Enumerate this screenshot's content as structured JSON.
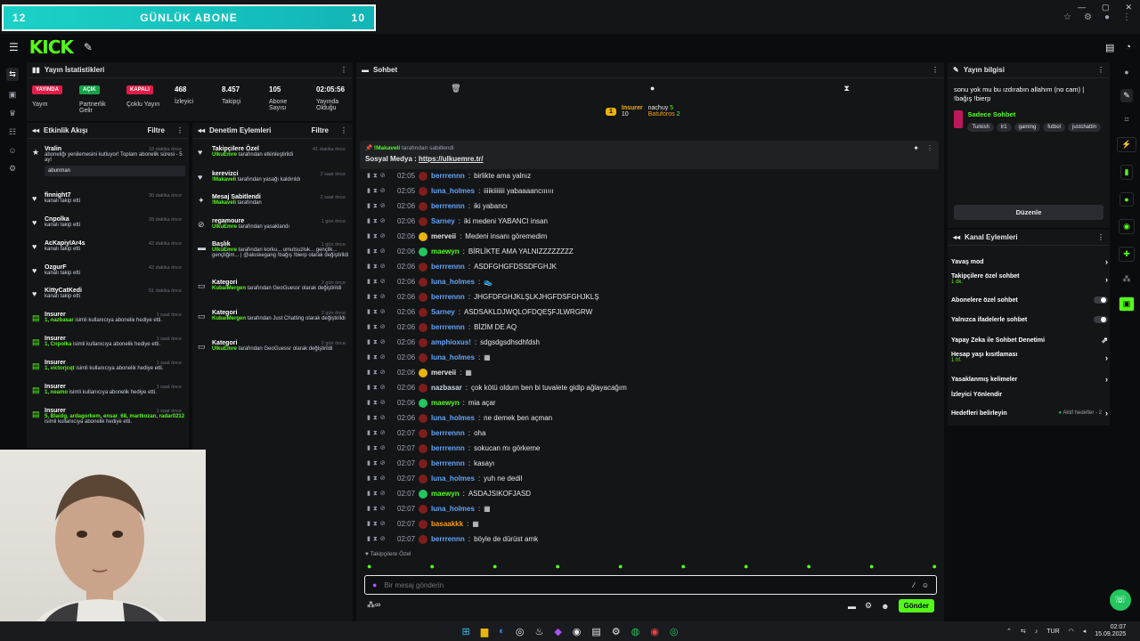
{
  "overlay": {
    "left": "12",
    "title": "GÜNLÜK ABONE",
    "right": "10"
  },
  "stats": {
    "title": "Yayın İstatistikleri",
    "badges": [
      {
        "text": "YAYINDA",
        "color": "#e11d48"
      },
      {
        "text": "AÇIK",
        "color": "#16a34a"
      },
      {
        "text": "KAPALI",
        "color": "#e11d48"
      }
    ],
    "labels": [
      "Yayın",
      "Partnerlik Gelir",
      "Çoklu Yayın"
    ],
    "values": [
      {
        "v": "468",
        "l": "İzleyici"
      },
      {
        "v": "8.457",
        "l": "Takipçi"
      },
      {
        "v": "105",
        "l": "Abone Sayısı"
      },
      {
        "v": "02:05:56",
        "l": "Yayında Olduğu"
      }
    ]
  },
  "feed": {
    "title": "Etkinlik Akışı",
    "filter": "Filtre",
    "items": [
      {
        "name": "Vralin",
        "time": "18 dakika önce",
        "text": "aboneliğı yenilemesini kutluyor! Toplam abonelik süresi - 5 ay!",
        "extra": "abunman"
      },
      {
        "name": "finnight7",
        "time": "30 dakika önce",
        "text": "kanalı takip etti"
      },
      {
        "name": "Cnpolka",
        "time": "39 dakika önce",
        "text": "kanalı takip etti"
      },
      {
        "name": "AcKapiyIAr4s",
        "time": "42 dakika önce",
        "text": "kanalı takip etti"
      },
      {
        "name": "OzgurF",
        "time": "42 dakika önce",
        "text": "kanalı takip etti"
      },
      {
        "name": "KittyCatKedi",
        "time": "51 dakika önce",
        "text": "kanalı takip etti"
      },
      {
        "name": "Insurer",
        "time": "1 saat önce",
        "hl": "1, nazbasar",
        "text": "isimli kullanıcıya aboneliк hediye etti."
      },
      {
        "name": "Insurer",
        "time": "1 saat önce",
        "hl": "1, Cnpolka",
        "text": "isimli kullanıcıya abonelik hediye etti."
      },
      {
        "name": "Insurer",
        "time": "1 saat önce",
        "hl": "1, victorjcqt",
        "text": "isimli kullanıcıya abonelik hediye etti."
      },
      {
        "name": "Insurer",
        "time": "1 saat önce",
        "hl": "1, neamo",
        "text": "isimli kullanıcıya abonelik hediye etti."
      },
      {
        "name": "Insurer",
        "time": "1 saat önce",
        "hl": "5, Blaidg, ardagorkem, ensar_68, martkozan, radar0212",
        "text": "isimli kullanıcıya abonelik hediye etti."
      }
    ]
  },
  "mod": {
    "title": "Denetim Eylemleri",
    "filter": "Filtre",
    "items": [
      {
        "title": "Takipçilere Özel",
        "time": "41 dakika önce",
        "who": "UlkuEmre",
        "text": "tarafından etkinleştirildi"
      },
      {
        "title": "kerevizci",
        "time": "2 saat önce",
        "who": "!Makaveli",
        "text": "tarafından yasağı kaldırıldı"
      },
      {
        "title": "Mesaj Sabitlendi",
        "time": "2 saat önce",
        "who": "!Makaveli",
        "text": "tarafından"
      },
      {
        "title": "regamoure",
        "time": "1 gün önce",
        "who": "UlkuEmre",
        "text": "tarafından yasaklandı"
      },
      {
        "title": "Başlık",
        "time": "1 gün önce",
        "who": "UlkuEmre",
        "text": "tarafından korku... umutsuzluk... gençlik... gençliğim... | @aloskegang !bağış !bierp olarak değiştirildi"
      },
      {
        "title": "Kategori",
        "time": "2 gün önce",
        "who": "KubaiMergen",
        "text": "tarafından GeoGuessr olarak değiştirildi"
      },
      {
        "title": "Kategori",
        "time": "2 gün önce",
        "who": "KubaiMergen",
        "text": "tarafından Just Chatting olarak değiştirildi"
      },
      {
        "title": "Kategori",
        "time": "2 gün önce",
        "who": "UlkuEmre",
        "text": "tarafından GeoGuessr olarak değiştirildi"
      }
    ]
  },
  "chat": {
    "title": "Sohbet",
    "top": {
      "insurer": "Insurer",
      "insurer_n": "10",
      "nachuy": "nachuy",
      "nachuy_n": "5",
      "batuforos": "Batuforos",
      "batuforos_n": "2"
    },
    "pinned": {
      "by": "!Makaveli",
      "by_text": "tarafından sabitlendi",
      "label": "Sosyal Medya :",
      "link": "https://ulkuemre.tr/"
    },
    "lines": [
      {
        "t": "02:05",
        "u": "berrrennn",
        "c": "#60a5fa",
        "m": "birlikte ama yalnız"
      },
      {
        "t": "02:05",
        "u": "luna_holmes",
        "c": "#60a5fa",
        "m": "iiiikiiiiiii yabaaaancıııııı"
      },
      {
        "t": "02:06",
        "u": "berrrennn",
        "c": "#60a5fa",
        "m": "iki yabancı"
      },
      {
        "t": "02:06",
        "u": "Sarney",
        "c": "#60a5fa",
        "m": "iki medeni YABANCI insan"
      },
      {
        "t": "02:06",
        "u": "merveii",
        "c": "#e5e7eb",
        "m": "Medeni insanı göremedim"
      },
      {
        "t": "02:06",
        "u": "maewyn",
        "c": "#53fc18",
        "m": "BİRLİKTE AMA YALNIZZZZZZZZ"
      },
      {
        "t": "02:06",
        "u": "berrrennn",
        "c": "#60a5fa",
        "m": "ASDFGHGFDSSDFGHJK"
      },
      {
        "t": "02:06",
        "u": "luna_holmes",
        "c": "#60a5fa",
        "m": "👟"
      },
      {
        "t": "02:06",
        "u": "berrrennn",
        "c": "#60a5fa",
        "m": "JHGFDFGHJKLŞLKJHGFDSFGHJKLŞ"
      },
      {
        "t": "02:06",
        "u": "Sarney",
        "c": "#60a5fa",
        "m": "ASDSAKLDJWQLOFDQEŞFJLWRGRW"
      },
      {
        "t": "02:06",
        "u": "berrrennn",
        "c": "#60a5fa",
        "m": "BİZİM DE AQ"
      },
      {
        "t": "02:06",
        "u": "amphioxus!",
        "c": "#60a5fa",
        "m": "sdgsdgsdhsdhfdsh"
      },
      {
        "t": "02:06",
        "u": "luna_holmes",
        "c": "#60a5fa",
        "m": "▦"
      },
      {
        "t": "02:06",
        "u": "merveii",
        "c": "#e5e7eb",
        "m": "▦"
      },
      {
        "t": "02:06",
        "u": "nazbasar",
        "c": "#cbd5e1",
        "m": "çok kötü oldum ben bi tuvalete gidip ağlayacağım"
      },
      {
        "t": "02:06",
        "u": "maewyn",
        "c": "#53fc18",
        "m": "mia açar"
      },
      {
        "t": "02:06",
        "u": "luna_holmes",
        "c": "#60a5fa",
        "m": "ne demek ben açman"
      },
      {
        "t": "02:07",
        "u": "berrrennn",
        "c": "#60a5fa",
        "m": "oha"
      },
      {
        "t": "02:07",
        "u": "berrrennn",
        "c": "#60a5fa",
        "m": "sokucan mı görkeme"
      },
      {
        "t": "02:07",
        "u": "berrrennn",
        "c": "#60a5fa",
        "m": "kasayı"
      },
      {
        "t": "02:07",
        "u": "luna_holmes",
        "c": "#60a5fa",
        "m": "yuh ne dedil"
      },
      {
        "t": "02:07",
        "u": "maewyn",
        "c": "#53fc18",
        "m": "ASDAJSIKOFJASD"
      },
      {
        "t": "02:07",
        "u": "luna_holmes",
        "c": "#60a5fa",
        "m": "▦"
      },
      {
        "t": "02:07",
        "u": "basaakkk",
        "c": "#f59e0b",
        "m": "▦"
      },
      {
        "t": "02:07",
        "u": "berrrennn",
        "c": "#60a5fa",
        "m": "böyle de dürüst amk"
      }
    ],
    "followers_only": "Takipçilere Özel",
    "input_placeholder": "Bir mesaj gönderin",
    "send": "Gönder"
  },
  "info": {
    "title": "Yayın bilgisi",
    "stream_title": "sonu yok mu bu ızdırabın allahım (no cam) | !bağış !bierp",
    "category": "Sadece Sohbet",
    "tags": [
      "Turkish",
      "lr1",
      "gaming",
      "futbol",
      "justchattin"
    ],
    "edit": "Düzenle"
  },
  "actions": {
    "title": "Kanal Eylemleri",
    "items": [
      {
        "label": "Yavaş mod",
        "type": "chev"
      },
      {
        "label": "Takipçilere özel sohbet",
        "sub": "1 dk.",
        "type": "chev"
      },
      {
        "label": "Abonelere özel sohbet",
        "type": "toggle"
      },
      {
        "label": "Yalnızca ifadelerle sohbet",
        "type": "toggle"
      },
      {
        "label": "Yapay Zeka ile Sohbet Denetimi",
        "type": "ext"
      },
      {
        "label": "Hesap yaşı kısıtlaması",
        "sub": "1 hf.",
        "type": "chev"
      },
      {
        "label": "Yasaklanmış kelimeler",
        "type": "chev"
      },
      {
        "label": "İzleyici Yönlendir",
        "type": "none"
      },
      {
        "label": "Hedefleri belirleyin",
        "extra": "Aktif hedefler - 2",
        "type": "chev"
      }
    ]
  },
  "taskbar": {
    "lang": "TUR",
    "time": "02:07",
    "date": "15.09.2025"
  }
}
